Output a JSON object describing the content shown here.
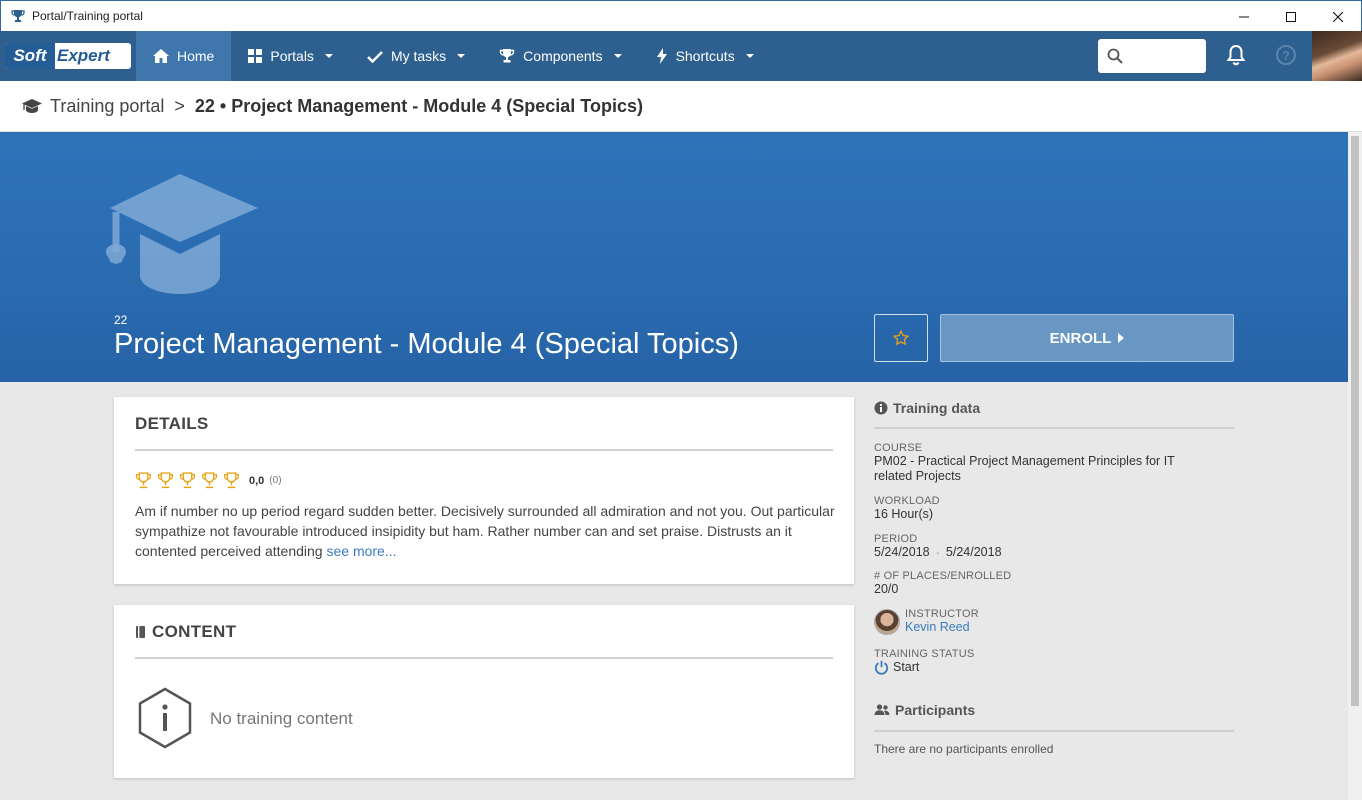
{
  "window": {
    "title": "Portal/Training portal"
  },
  "nav": {
    "logo_part1": "Soft",
    "logo_part2": "Expert",
    "items": [
      {
        "label": "Home",
        "icon": "home-icon"
      },
      {
        "label": "Portals",
        "icon": "grid-icon"
      },
      {
        "label": "My tasks",
        "icon": "check-icon"
      },
      {
        "label": "Components",
        "icon": "trophy-icon"
      },
      {
        "label": "Shortcuts",
        "icon": "bolt-icon"
      }
    ],
    "search_placeholder": "",
    "help_label": "?"
  },
  "breadcrumb": {
    "root": "Training portal",
    "separator": ">",
    "current": "22 • Project Management - Module 4 (Special Topics)"
  },
  "hero": {
    "code": "22",
    "title": "Project Management - Module 4 (Special Topics)",
    "enroll_label": "ENROLL"
  },
  "details": {
    "heading": "DETAILS",
    "rating_score": "0,0",
    "rating_count": "(0)",
    "rating_stars": 5,
    "description": "Am if number no up period regard sudden better. Decisively surrounded all admiration and not you. Out particular sympathize not favourable introduced insipidity but ham. Rather number can and set praise. Distrusts an it contented perceived attending",
    "see_more": "see more..."
  },
  "content": {
    "heading": "CONTENT",
    "empty_message": "No training content"
  },
  "training_data": {
    "heading": "Training data",
    "course_label": "COURSE",
    "course_value": "PM02 - Practical Project Management Principles for IT related Projects",
    "workload_label": "WORKLOAD",
    "workload_value": "16 Hour(s)",
    "period_label": "PERIOD",
    "period_start": "5/24/2018",
    "period_sep": "-",
    "period_end": "5/24/2018",
    "places_label": "# OF PLACES/ENROLLED",
    "places_value": "20/0",
    "instructor_label": "INSTRUCTOR",
    "instructor_value": "Kevin Reed",
    "status_label": "TRAINING STATUS",
    "status_value": "Start"
  },
  "participants": {
    "heading": "Participants",
    "empty_message": "There are no participants enrolled"
  },
  "colors": {
    "nav_bg": "#2d5f8f",
    "nav_active": "#3f77ad",
    "hero_bg": "#2a6bb0",
    "link": "#3b7bbf",
    "trophy": "#e8a317",
    "enroll_bg": "#6897c4"
  }
}
